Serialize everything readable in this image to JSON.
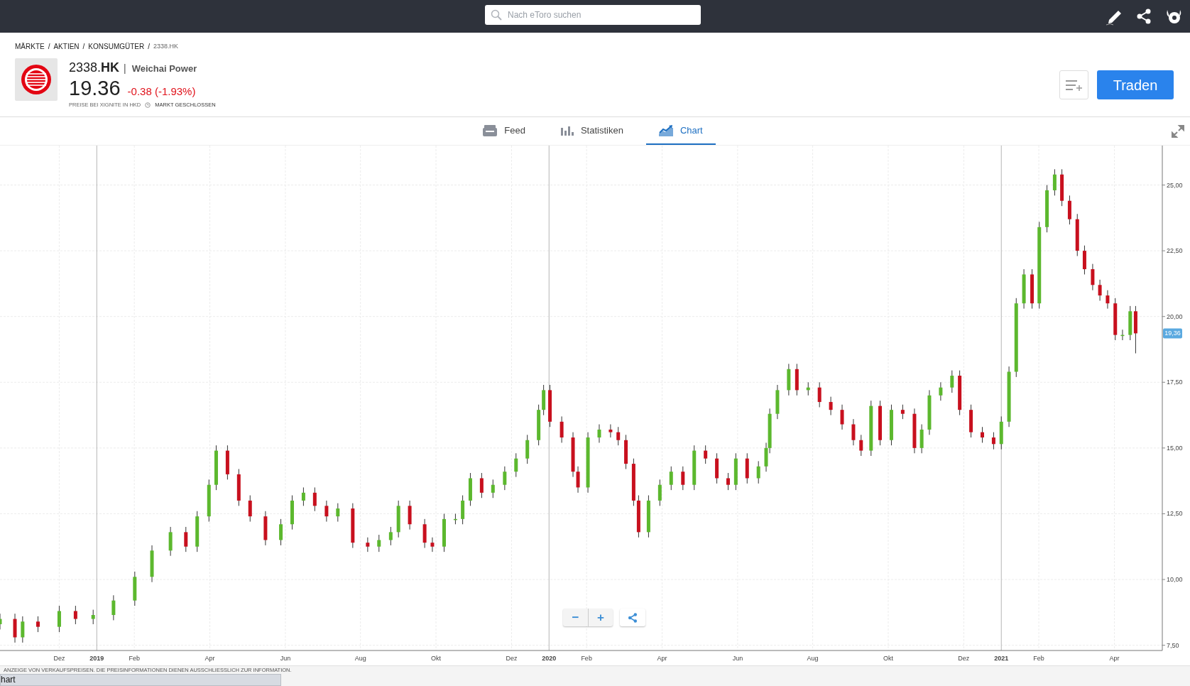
{
  "topbar": {
    "search": {
      "placeholder": "Nach eToro suchen"
    }
  },
  "breadcrumb": {
    "separator": "/",
    "items": [
      "MÄRKTE",
      "AKTIEN",
      "KONSUMGÜTER",
      "2338.HK"
    ]
  },
  "instrument": {
    "symbol": "2338.**HK**",
    "separator": "|",
    "name": "Weichai Power",
    "price": "19.36",
    "change": "-0.38 (-1.93%)",
    "source": "PREISE BEI XIGNITE IN HKD",
    "market_status": "MARKT GESCHLOSSEN",
    "trade_button": "Traden"
  },
  "tabs": [
    {
      "label": "Feed",
      "kind": "feed",
      "selected": false
    },
    {
      "label": "Statistiken",
      "kind": "stats",
      "selected": false
    },
    {
      "label": "Chart",
      "kind": "chart",
      "selected": true
    }
  ],
  "chart": {
    "chart_data": {
      "type": "candlestick",
      "grid": true,
      "xlim": [
        2018.786,
        2021.356
      ],
      "ylim": [
        7.3,
        26.5
      ],
      "xticks": [
        {
          "value": 2018.917,
          "label": "Dez"
        },
        {
          "value": 2019,
          "label": "2019"
        },
        {
          "value": 2019.083,
          "label": "Feb"
        },
        {
          "value": 2019.25,
          "label": "Apr"
        },
        {
          "value": 2019.417,
          "label": "Jun"
        },
        {
          "value": 2019.583,
          "label": "Aug"
        },
        {
          "value": 2019.75,
          "label": "Okt"
        },
        {
          "value": 2019.917,
          "label": "Dez"
        },
        {
          "value": 2020,
          "label": "2020"
        },
        {
          "value": 2020.083,
          "label": "Feb"
        },
        {
          "value": 2020.25,
          "label": "Apr"
        },
        {
          "value": 2020.417,
          "label": "Jun"
        },
        {
          "value": 2020.583,
          "label": "Aug"
        },
        {
          "value": 2020.75,
          "label": "Okt"
        },
        {
          "value": 2020.917,
          "label": "Dez"
        },
        {
          "value": 2021,
          "label": "2021"
        },
        {
          "value": 2021.083,
          "label": "Feb"
        },
        {
          "value": 2021.25,
          "label": "Apr"
        }
      ],
      "yticks": [
        {
          "value": 7.5,
          "label": "7,50"
        },
        {
          "value": 10,
          "label": "10,00"
        },
        {
          "value": 12.5,
          "label": "12,50"
        },
        {
          "value": 15,
          "label": "15,00"
        },
        {
          "value": 17.5,
          "label": "17,50"
        },
        {
          "value": 20,
          "label": "20,00"
        },
        {
          "value": 22.5,
          "label": "22,50"
        },
        {
          "value": 25,
          "label": "25,00"
        }
      ],
      "x": [
        2018.786,
        2018.819,
        2018.836,
        2018.87,
        2018.917,
        2018.953,
        2018.992,
        2019.037,
        2019.084,
        2019.122,
        2019.163,
        2019.197,
        2019.222,
        2019.248,
        2019.264,
        2019.289,
        2019.314,
        2019.339,
        2019.373,
        2019.407,
        2019.432,
        2019.457,
        2019.482,
        2019.508,
        2019.533,
        2019.566,
        2019.599,
        2019.624,
        2019.65,
        2019.667,
        2019.692,
        2019.725,
        2019.742,
        2019.768,
        2019.793,
        2019.809,
        2019.826,
        2019.851,
        2019.876,
        2019.902,
        2019.927,
        2019.952,
        2019.977,
        2019.988,
        2020.002,
        2020.028,
        2020.053,
        2020.064,
        2020.086,
        2020.111,
        2020.136,
        2020.153,
        2020.17,
        2020.187,
        2020.198,
        2020.22,
        2020.245,
        2020.27,
        2020.296,
        2020.321,
        2020.346,
        2020.371,
        2020.396,
        2020.413,
        2020.438,
        2020.463,
        2020.48,
        2020.488,
        2020.505,
        2020.53,
        2020.548,
        2020.573,
        2020.598,
        2020.623,
        2020.648,
        2020.673,
        2020.69,
        2020.712,
        2020.732,
        2020.757,
        2020.782,
        2020.808,
        2020.824,
        2020.841,
        2020.866,
        2020.891,
        2020.908,
        2020.933,
        2020.958,
        2020.983,
        2021.0,
        2021.017,
        2021.033,
        2021.05,
        2021.068,
        2021.084,
        2021.101,
        2021.118,
        2021.134,
        2021.151,
        2021.168,
        2021.184,
        2021.202,
        2021.218,
        2021.235,
        2021.252,
        2021.268,
        2021.285,
        2021.297
      ],
      "ohlc": [
        [
          8.3,
          8.7,
          8.1,
          8.5
        ],
        [
          8.5,
          8.7,
          7.6,
          7.8
        ],
        [
          7.8,
          8.6,
          7.6,
          8.4
        ],
        [
          8.4,
          8.6,
          8.0,
          8.2
        ],
        [
          8.2,
          9.0,
          8.0,
          8.8
        ],
        [
          8.8,
          9.0,
          8.3,
          8.5
        ],
        [
          8.5,
          8.85,
          8.3,
          8.65
        ],
        [
          8.65,
          9.4,
          8.45,
          9.2
        ],
        [
          9.2,
          10.3,
          9.0,
          10.1
        ],
        [
          10.1,
          11.3,
          9.9,
          11.1
        ],
        [
          11.1,
          12.0,
          10.9,
          11.8
        ],
        [
          11.8,
          12.0,
          11.05,
          11.25
        ],
        [
          11.25,
          12.6,
          11.05,
          12.4
        ],
        [
          12.4,
          13.8,
          12.2,
          13.6
        ],
        [
          13.6,
          15.1,
          13.4,
          14.9
        ],
        [
          14.9,
          15.1,
          13.8,
          14.0
        ],
        [
          14.0,
          14.2,
          12.8,
          13.0
        ],
        [
          13.0,
          13.2,
          12.2,
          12.4
        ],
        [
          12.4,
          12.6,
          11.3,
          11.5
        ],
        [
          11.5,
          12.3,
          11.3,
          12.1
        ],
        [
          12.1,
          13.2,
          11.9,
          13.0
        ],
        [
          13.0,
          13.5,
          12.8,
          13.3
        ],
        [
          13.3,
          13.5,
          12.6,
          12.8
        ],
        [
          12.8,
          13.0,
          12.2,
          12.4
        ],
        [
          12.4,
          12.9,
          12.2,
          12.7
        ],
        [
          12.7,
          12.9,
          11.2,
          11.4
        ],
        [
          11.4,
          11.6,
          11.05,
          11.25
        ],
        [
          11.25,
          11.7,
          11.05,
          11.5
        ],
        [
          11.5,
          12.0,
          11.3,
          11.8
        ],
        [
          11.8,
          13.0,
          11.6,
          12.8
        ],
        [
          12.8,
          13.0,
          11.9,
          12.1
        ],
        [
          12.1,
          12.3,
          11.2,
          11.4
        ],
        [
          11.4,
          11.6,
          11.05,
          11.25
        ],
        [
          11.25,
          12.5,
          11.05,
          12.3
        ],
        [
          12.3,
          12.5,
          12.1,
          12.3
        ],
        [
          12.3,
          13.2,
          12.1,
          13.0
        ],
        [
          13.0,
          14.05,
          12.8,
          13.85
        ],
        [
          13.85,
          14.05,
          13.1,
          13.3
        ],
        [
          13.3,
          13.8,
          13.1,
          13.6
        ],
        [
          13.6,
          14.3,
          13.4,
          14.1
        ],
        [
          14.1,
          14.8,
          13.9,
          14.6
        ],
        [
          14.6,
          15.5,
          14.4,
          15.3
        ],
        [
          15.3,
          16.65,
          15.1,
          16.45
        ],
        [
          16.45,
          17.4,
          16.25,
          17.2
        ],
        [
          17.2,
          17.4,
          15.8,
          16.0
        ],
        [
          16.0,
          16.2,
          15.2,
          15.4
        ],
        [
          15.4,
          15.6,
          13.9,
          14.1
        ],
        [
          14.1,
          14.3,
          13.3,
          13.5
        ],
        [
          13.5,
          15.6,
          13.3,
          15.4
        ],
        [
          15.4,
          15.9,
          15.2,
          15.7
        ],
        [
          15.7,
          15.9,
          15.4,
          15.6
        ],
        [
          15.6,
          15.8,
          15.1,
          15.3
        ],
        [
          15.3,
          15.5,
          14.2,
          14.4
        ],
        [
          14.4,
          14.6,
          12.8,
          13.0
        ],
        [
          13.0,
          13.2,
          11.6,
          11.8
        ],
        [
          11.8,
          13.2,
          11.6,
          13.0
        ],
        [
          13.0,
          13.8,
          12.8,
          13.6
        ],
        [
          13.6,
          14.3,
          13.4,
          14.1
        ],
        [
          14.1,
          14.3,
          13.4,
          13.6
        ],
        [
          13.6,
          15.1,
          13.4,
          14.9
        ],
        [
          14.9,
          15.1,
          14.4,
          14.6
        ],
        [
          14.6,
          14.8,
          13.65,
          13.85
        ],
        [
          13.85,
          14.05,
          13.4,
          13.6
        ],
        [
          13.6,
          14.8,
          13.4,
          14.6
        ],
        [
          14.6,
          14.8,
          13.65,
          13.85
        ],
        [
          13.85,
          14.5,
          13.65,
          14.3
        ],
        [
          14.3,
          15.2,
          14.1,
          15.0
        ],
        [
          15.0,
          16.5,
          14.8,
          16.3
        ],
        [
          16.3,
          17.4,
          16.1,
          17.2
        ],
        [
          17.2,
          18.2,
          17.0,
          18.0
        ],
        [
          18.0,
          18.2,
          17.0,
          17.2
        ],
        [
          17.2,
          17.5,
          17.0,
          17.3
        ],
        [
          17.3,
          17.5,
          16.55,
          16.75
        ],
        [
          16.75,
          16.95,
          16.25,
          16.45
        ],
        [
          16.45,
          16.65,
          15.7,
          15.9
        ],
        [
          15.9,
          16.1,
          15.1,
          15.3
        ],
        [
          15.3,
          15.5,
          14.7,
          14.9
        ],
        [
          14.9,
          16.8,
          14.7,
          16.6
        ],
        [
          16.6,
          16.8,
          15.1,
          15.3
        ],
        [
          15.3,
          16.65,
          15.1,
          16.45
        ],
        [
          16.45,
          16.65,
          16.1,
          16.3
        ],
        [
          16.3,
          16.5,
          14.8,
          15.0
        ],
        [
          15.0,
          15.9,
          14.8,
          15.7
        ],
        [
          15.7,
          17.2,
          15.5,
          17.0
        ],
        [
          17.0,
          17.5,
          16.8,
          17.3
        ],
        [
          17.3,
          17.95,
          17.1,
          17.75
        ],
        [
          17.75,
          17.95,
          16.25,
          16.45
        ],
        [
          16.45,
          16.65,
          15.4,
          15.6
        ],
        [
          15.6,
          15.8,
          15.2,
          15.4
        ],
        [
          15.4,
          15.6,
          14.95,
          15.15
        ],
        [
          15.15,
          16.2,
          14.95,
          16.0
        ],
        [
          16.0,
          18.1,
          15.8,
          17.9
        ],
        [
          17.9,
          20.7,
          17.7,
          20.5
        ],
        [
          20.5,
          21.8,
          20.3,
          21.6
        ],
        [
          21.6,
          21.8,
          20.3,
          20.5
        ],
        [
          20.5,
          23.6,
          20.3,
          23.4
        ],
        [
          23.4,
          25.0,
          23.2,
          24.8
        ],
        [
          24.8,
          25.6,
          24.6,
          25.4
        ],
        [
          25.4,
          25.6,
          24.2,
          24.4
        ],
        [
          24.4,
          24.6,
          23.5,
          23.7
        ],
        [
          23.7,
          23.9,
          22.3,
          22.5
        ],
        [
          22.5,
          22.7,
          21.6,
          21.8
        ],
        [
          21.8,
          22.0,
          21.0,
          21.2
        ],
        [
          21.2,
          21.4,
          20.6,
          20.8
        ],
        [
          20.8,
          21.0,
          20.3,
          20.5
        ],
        [
          20.5,
          20.7,
          19.1,
          19.3
        ],
        [
          19.3,
          19.5,
          19.1,
          19.3
        ],
        [
          19.3,
          20.4,
          19.1,
          20.2
        ],
        [
          20.2,
          20.4,
          18.6,
          19.36
        ]
      ],
      "annotations": [
        "19,36"
      ]
    },
    "zoom_controls": [
      "−",
      "+"
    ]
  },
  "footer": {
    "disclaimer": "ANZEIGE VON VERKAUFSPREISEN. DIE PREISINFORMATIONEN DIENEN AUSSCHLIESSLICH ZUR INFORMATION.",
    "tab": "hart"
  }
}
